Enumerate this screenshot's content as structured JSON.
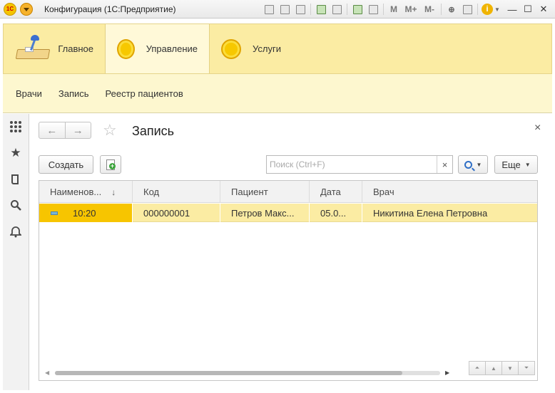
{
  "window": {
    "title": "Конфигурация  (1С:Предприятие)",
    "logo_text": "1С",
    "toolbar_letters": [
      "M",
      "M+",
      "M-"
    ]
  },
  "sections": [
    {
      "label": "Главное",
      "icon": "desk-lamp-icon",
      "active": false
    },
    {
      "label": "Управление",
      "icon": "circle-icon",
      "active": true
    },
    {
      "label": "Услуги",
      "icon": "circle-icon",
      "active": false
    }
  ],
  "subnav": [
    "Врачи",
    "Запись",
    "Реестр пациентов"
  ],
  "form": {
    "title": "Запись",
    "create_label": "Создать",
    "more_label": "Еще",
    "search_placeholder": "Поиск (Ctrl+F)",
    "search_value": ""
  },
  "table": {
    "columns": [
      "Наименов...",
      "Код",
      "Пациент",
      "Дата",
      "Врач"
    ],
    "sort_indicator": "↓",
    "rows": [
      [
        "10:20",
        "000000001",
        "Петров Макс...",
        "05.0...",
        "Никитина Елена Петровна"
      ]
    ]
  },
  "colors": {
    "accent_yellow": "#f7c500",
    "section_bg": "#fbeca3",
    "subnav_bg": "#fdf7cf"
  }
}
